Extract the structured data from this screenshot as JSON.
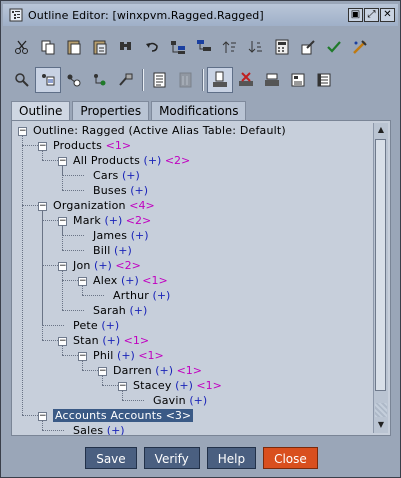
{
  "window": {
    "title": "Outline Editor: [winxpvm.Ragged.Ragged]",
    "buttons": [
      "▣",
      "⤢",
      "✕"
    ]
  },
  "toolbar1_icons": [
    "cut-icon",
    "copy-icon",
    "paste-icon",
    "paste-special-icon",
    "find-icon",
    "undo-icon",
    "add-sibling-icon",
    "add-child-icon",
    "sort-ascending-icon",
    "sort-descending-icon",
    "calculator-icon",
    "edit-icon",
    "check-icon",
    "restructure-icon"
  ],
  "toolbar2_icons": [
    "member-properties-icon",
    "selected-view-icon",
    "expand-icon",
    "collapse-icon",
    "formula-icon",
    "properties-icon",
    "disabled-icon",
    "save-icon",
    "delete-icon",
    "verify-icon",
    "settings-icon",
    "export-icon"
  ],
  "tabs": [
    {
      "label": "Outline",
      "active": true
    },
    {
      "label": "Properties",
      "active": false
    },
    {
      "label": "Modifications",
      "active": false
    }
  ],
  "tree": {
    "rows": [
      {
        "level": 0,
        "exp": "minus",
        "name": "Outline: Ragged (Active Alias Table: Default)",
        "plus": "",
        "count": ""
      },
      {
        "level": 1,
        "exp": "minus",
        "name": "Products",
        "plus": "",
        "count": "<1>"
      },
      {
        "level": 2,
        "exp": "minus",
        "name": "All Products",
        "plus": "(+)",
        "count": "<2>"
      },
      {
        "level": 3,
        "exp": "",
        "name": "Cars",
        "plus": "(+)",
        "count": ""
      },
      {
        "level": 3,
        "exp": "",
        "name": "Buses",
        "plus": "(+)",
        "count": ""
      },
      {
        "level": 1,
        "exp": "minus",
        "name": "Organization",
        "plus": "",
        "count": "<4>"
      },
      {
        "level": 2,
        "exp": "minus",
        "name": "Mark",
        "plus": "(+)",
        "count": "<2>"
      },
      {
        "level": 3,
        "exp": "",
        "name": "James",
        "plus": "(+)",
        "count": ""
      },
      {
        "level": 3,
        "exp": "",
        "name": "Bill",
        "plus": "(+)",
        "count": ""
      },
      {
        "level": 2,
        "exp": "minus",
        "name": "Jon",
        "plus": "(+)",
        "count": "<2>"
      },
      {
        "level": 3,
        "exp": "minus",
        "name": "Alex",
        "plus": "(+)",
        "count": "<1>"
      },
      {
        "level": 4,
        "exp": "",
        "name": "Arthur",
        "plus": "(+)",
        "count": ""
      },
      {
        "level": 3,
        "exp": "",
        "name": "Sarah",
        "plus": "(+)",
        "count": ""
      },
      {
        "level": 2,
        "exp": "",
        "name": "Pete",
        "plus": "(+)",
        "count": ""
      },
      {
        "level": 2,
        "exp": "minus",
        "name": "Stan",
        "plus": "(+)",
        "count": "<1>"
      },
      {
        "level": 3,
        "exp": "minus",
        "name": "Phil",
        "plus": "(+)",
        "count": "<1>"
      },
      {
        "level": 4,
        "exp": "minus",
        "name": "Darren",
        "plus": "(+)",
        "count": "<1>"
      },
      {
        "level": 5,
        "exp": "minus",
        "name": "Stacey",
        "plus": "(+)",
        "count": "<1>"
      },
      {
        "level": 6,
        "exp": "",
        "name": "Gavin",
        "plus": "(+)",
        "count": ""
      },
      {
        "level": 1,
        "exp": "minus",
        "name": "Accounts Accounts",
        "plus": "",
        "count": "<3>",
        "selected": true
      },
      {
        "level": 2,
        "exp": "",
        "name": "Sales",
        "plus": "(+)",
        "count": ""
      }
    ]
  },
  "footer": {
    "save": "Save",
    "verify": "Verify",
    "help": "Help",
    "close": "Close"
  },
  "colors": {
    "accent_close": "#d94f1e",
    "button": "#4a5f80",
    "selection": "#3a5a86",
    "plus_text": "#1a24b8",
    "count_text": "#c000c0"
  }
}
